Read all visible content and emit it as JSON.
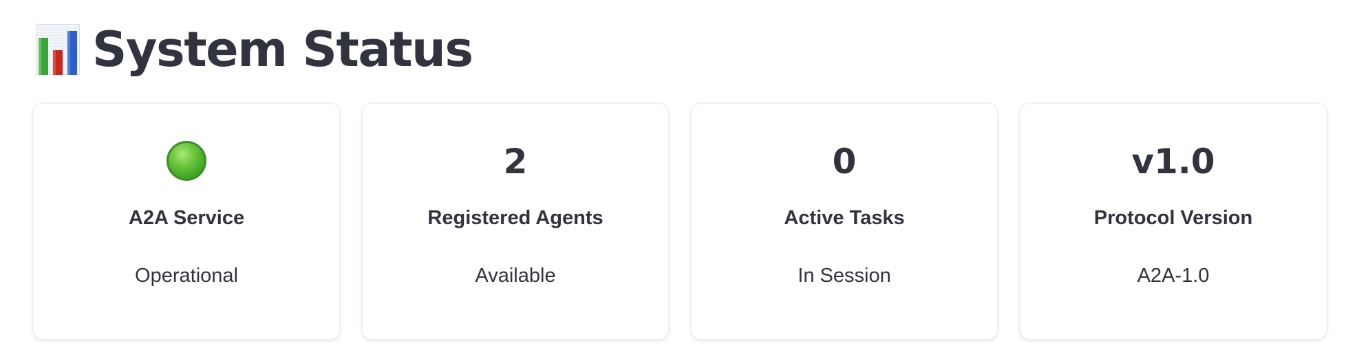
{
  "header": {
    "icon": "bar-chart-icon",
    "title": "System Status"
  },
  "colors": {
    "text": "#31333f",
    "status_green": "#43a726",
    "card_background": "#ffffff"
  },
  "cards": [
    {
      "icon": "green-circle-icon",
      "label": "A2A Service",
      "sub": "Operational"
    },
    {
      "value": "2",
      "label": "Registered Agents",
      "sub": "Available"
    },
    {
      "value": "0",
      "label": "Active Tasks",
      "sub": "In Session"
    },
    {
      "value": "v1.0",
      "label": "Protocol Version",
      "sub": "A2A-1.0"
    }
  ]
}
